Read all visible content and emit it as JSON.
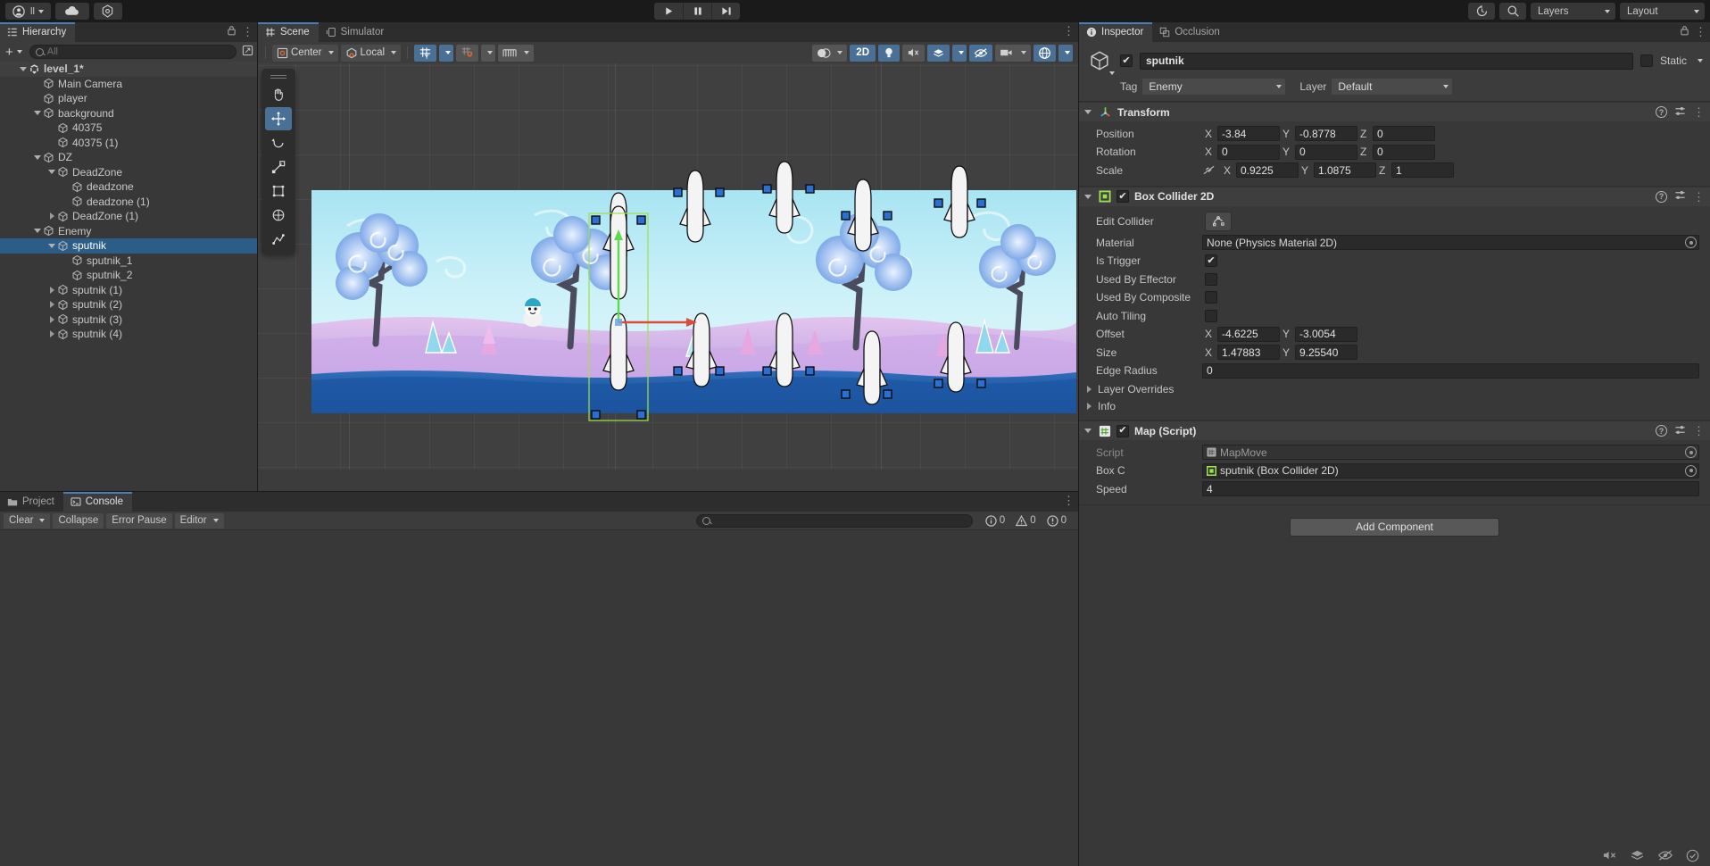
{
  "topbar": {
    "account_label": "",
    "cloud_label": "",
    "settings_label": "",
    "undo_label": "",
    "search_label": "",
    "layers_label": "Layers",
    "layout_label": "Layout",
    "play_label": "Play",
    "pause_label": "Pause",
    "step_label": "Step"
  },
  "hierarchy": {
    "tab_label": "Hierarchy",
    "create_label": "+",
    "search_placeholder": "All",
    "search_value": "",
    "items": [
      {
        "label": "level_1*",
        "depth": 0,
        "expand": "down",
        "icon": "unity-icon",
        "selected": false,
        "root": true
      },
      {
        "label": "Main Camera",
        "depth": 1,
        "expand": "none",
        "icon": "cube-icon",
        "selected": false
      },
      {
        "label": "player",
        "depth": 1,
        "expand": "none",
        "icon": "cube-icon",
        "selected": false
      },
      {
        "label": "background",
        "depth": 1,
        "expand": "down",
        "icon": "cube-icon",
        "selected": false
      },
      {
        "label": "40375",
        "depth": 2,
        "expand": "none",
        "icon": "cube-icon",
        "selected": false
      },
      {
        "label": "40375 (1)",
        "depth": 2,
        "expand": "none",
        "icon": "cube-icon",
        "selected": false
      },
      {
        "label": "DZ",
        "depth": 1,
        "expand": "down",
        "icon": "cube-icon",
        "selected": false
      },
      {
        "label": "DeadZone",
        "depth": 2,
        "expand": "down",
        "icon": "cube-icon",
        "selected": false
      },
      {
        "label": "deadzone",
        "depth": 3,
        "expand": "none",
        "icon": "cube-icon",
        "selected": false
      },
      {
        "label": "deadzone (1)",
        "depth": 3,
        "expand": "none",
        "icon": "cube-icon",
        "selected": false
      },
      {
        "label": "DeadZone (1)",
        "depth": 2,
        "expand": "right",
        "icon": "cube-icon",
        "selected": false
      },
      {
        "label": "Enemy",
        "depth": 1,
        "expand": "down",
        "icon": "cube-icon",
        "selected": false
      },
      {
        "label": "sputnik",
        "depth": 2,
        "expand": "down",
        "icon": "cube-icon",
        "selected": true
      },
      {
        "label": "sputnik_1",
        "depth": 3,
        "expand": "none",
        "icon": "cube-icon",
        "selected": false
      },
      {
        "label": "sputnik_2",
        "depth": 3,
        "expand": "none",
        "icon": "cube-icon",
        "selected": false
      },
      {
        "label": "sputnik (1)",
        "depth": 2,
        "expand": "right",
        "icon": "cube-icon",
        "selected": false
      },
      {
        "label": "sputnik (2)",
        "depth": 2,
        "expand": "right",
        "icon": "cube-icon",
        "selected": false
      },
      {
        "label": "sputnik (3)",
        "depth": 2,
        "expand": "right",
        "icon": "cube-icon",
        "selected": false
      },
      {
        "label": "sputnik (4)",
        "depth": 2,
        "expand": "right",
        "icon": "cube-icon",
        "selected": false
      }
    ]
  },
  "scene": {
    "tabs": [
      {
        "label": "Scene",
        "icon": "grid-icon",
        "active": true
      },
      {
        "label": "Simulator",
        "icon": "device-icon",
        "active": false
      }
    ],
    "toolbar": {
      "pivot_label": "Center",
      "handle_label": "Local",
      "grid_snap_label": "",
      "snap_label": "",
      "ruler_label": "",
      "twod_label": "2D",
      "light_label": "",
      "audio_label": "",
      "fx_label": "",
      "hidden_label": "",
      "camera_label": "",
      "gizmos_label": ""
    }
  },
  "console": {
    "tabs": [
      {
        "label": "Project",
        "icon": "folder-icon",
        "active": false
      },
      {
        "label": "Console",
        "icon": "console-icon",
        "active": true
      }
    ],
    "clear_label": "Clear",
    "collapse_label": "Collapse",
    "error_pause_label": "Error Pause",
    "editor_label": "Editor",
    "search_placeholder": "",
    "search_value": "",
    "info_count": "0",
    "warning_count": "0",
    "error_count": "0"
  },
  "inspector": {
    "tabs": [
      {
        "label": "Inspector",
        "icon": "info-icon",
        "active": true
      },
      {
        "label": "Occlusion",
        "icon": "occlusion-icon",
        "active": false
      }
    ],
    "object": {
      "enabled": true,
      "name": "sputnik",
      "static_label": "Static",
      "static_checked": false,
      "tag_label": "Tag",
      "tag_value": "Enemy",
      "layer_label": "Layer",
      "layer_value": "Default"
    },
    "components": [
      {
        "title": "Transform",
        "icon": "transform-icon",
        "has_checkbox": false,
        "rows": [
          {
            "label": "Position",
            "type": "vec3",
            "x": "-3.84",
            "y": "-0.8778",
            "z": "0"
          },
          {
            "label": "Rotation",
            "type": "vec3",
            "x": "0",
            "y": "0",
            "z": "0"
          },
          {
            "label": "Scale",
            "type": "vec3",
            "link": true,
            "x": "0.9225",
            "y": "1.0875",
            "z": "1"
          }
        ]
      },
      {
        "title": "Box Collider 2D",
        "icon": "collider2d-icon",
        "has_checkbox": true,
        "checked": true,
        "rows": [
          {
            "label": "Edit Collider",
            "type": "button",
            "value": ""
          },
          {
            "label": "Material",
            "type": "object",
            "value": "None (Physics Material 2D)",
            "has_swatch": false
          },
          {
            "label": "Is Trigger",
            "type": "check",
            "checked": true
          },
          {
            "label": "Used By Effector",
            "type": "check",
            "checked": false
          },
          {
            "label": "Used By Composite",
            "type": "check",
            "checked": false
          },
          {
            "label": "Auto Tiling",
            "type": "check",
            "checked": false
          },
          {
            "label": "Offset",
            "type": "vec2",
            "x": "-4.6225",
            "y": "-3.0054"
          },
          {
            "label": "Size",
            "type": "vec2",
            "x": "1.47883",
            "y": "9.25540"
          },
          {
            "label": "Edge Radius",
            "type": "num",
            "value": "0"
          },
          {
            "label": "Layer Overrides",
            "type": "fold"
          },
          {
            "label": "Info",
            "type": "fold"
          }
        ]
      },
      {
        "title": "Map (Script)",
        "icon": "script-icon",
        "has_checkbox": true,
        "checked": true,
        "rows": [
          {
            "label": "Script",
            "type": "object",
            "value": "MapMove",
            "dim": true,
            "has_swatch": false
          },
          {
            "label": "Box C",
            "type": "object",
            "value": "sputnik (Box Collider 2D)",
            "has_swatch": true
          },
          {
            "label": "Speed",
            "type": "num",
            "value": "4"
          }
        ]
      }
    ],
    "add_component_label": "Add Component"
  },
  "colors": {
    "accent_blue": "#4a7eb5",
    "selection_blue": "#2c5d87",
    "handle_blue": "#2c6fd4",
    "green": "#9ee04a",
    "panel_bg": "#383838",
    "toolbar_bg": "#3c3c3c"
  }
}
